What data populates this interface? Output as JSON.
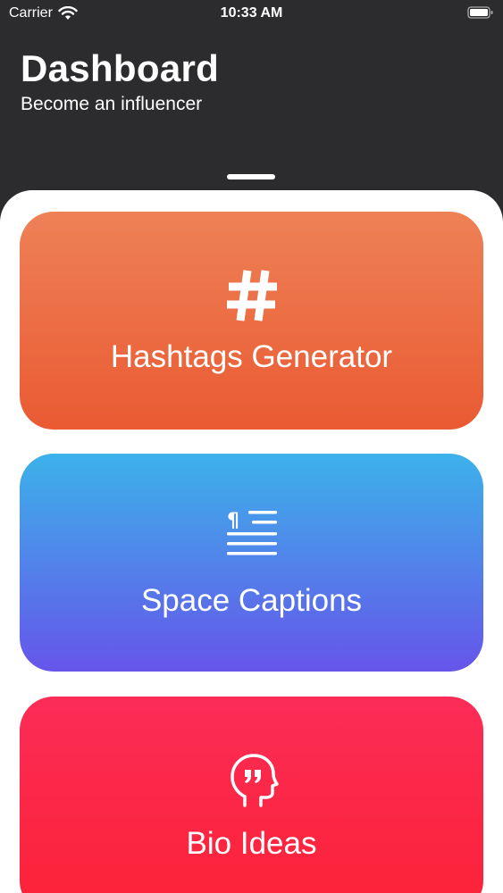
{
  "status_bar": {
    "carrier": "Carrier",
    "time": "10:33 AM"
  },
  "header": {
    "title": "Dashboard",
    "subtitle": "Become an influencer"
  },
  "cards": [
    {
      "label": "Hashtags Generator",
      "icon": "hashtag-icon",
      "colors": [
        "#ee8156",
        "#ea5a33"
      ]
    },
    {
      "label": "Space Captions",
      "icon": "captions-icon",
      "colors": [
        "#3cb2ea",
        "#6655ea"
      ]
    },
    {
      "label": "Bio Ideas",
      "icon": "bio-head-quote-icon",
      "colors": [
        "#fb2c57",
        "#fc2236"
      ]
    }
  ]
}
